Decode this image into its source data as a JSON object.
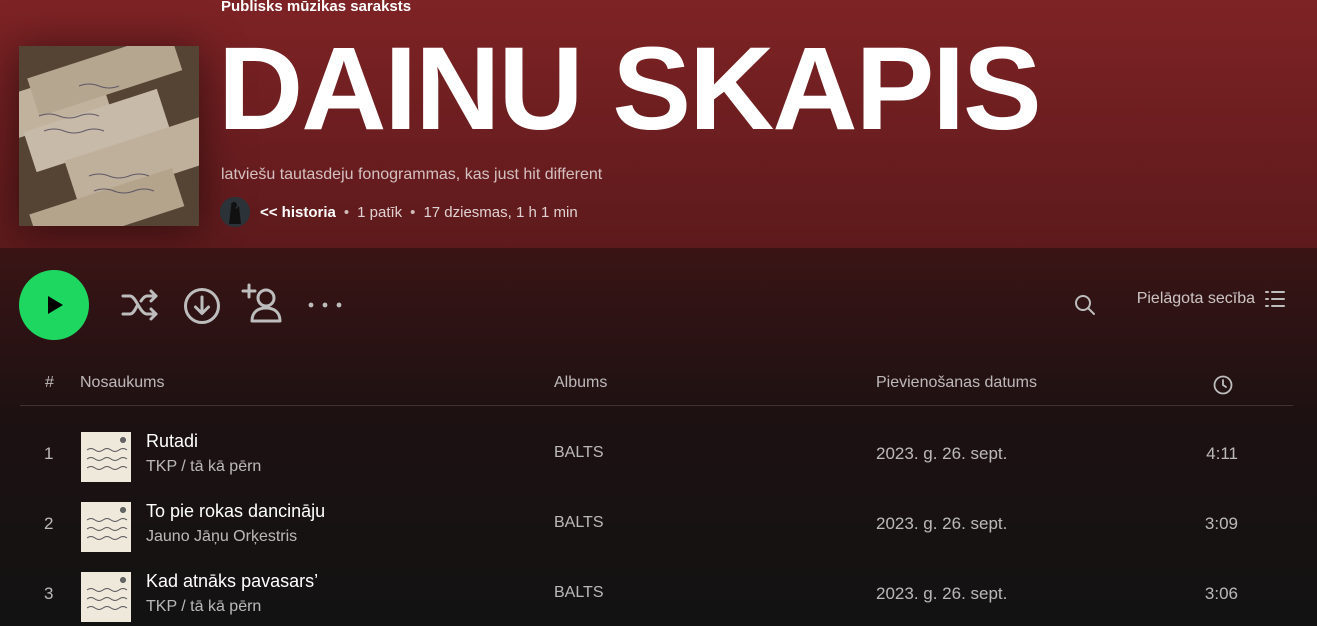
{
  "playlist": {
    "type_label": "Publisks mūzikas saraksts",
    "title": "DAINU SKAPIS",
    "description": "latviešu tautasdeju fonogrammas, kas just hit different",
    "owner": "<< historia",
    "likes": "1 patīk",
    "summary": "17 dziesmas, 1 h 1 min",
    "separator": "•"
  },
  "colors": {
    "header": "#7e2325",
    "accent": "#1ed760",
    "background": "#121212"
  },
  "controls": {
    "play_icon": "play-icon",
    "shuffle_icon": "shuffle-icon",
    "download_icon": "download-icon",
    "add_user_icon": "add-user-icon",
    "more_icon": "more-icon",
    "search_icon": "search-icon",
    "sort_label": "Pielāgota secība",
    "sort_icon": "list-icon"
  },
  "table": {
    "headers": {
      "number": "#",
      "title": "Nosaukums",
      "album": "Albums",
      "date_added": "Pievienošanas datums",
      "duration_icon": "clock-icon"
    },
    "rows": [
      {
        "number": "1",
        "title": "Rutadi",
        "artist": "TKP / tā kā pērn",
        "album": "BALTS",
        "date": "2023. g. 26. sept.",
        "duration": "4:11"
      },
      {
        "number": "2",
        "title": "To pie rokas dancināju",
        "artist": "Jauno Jāņu Orķestris",
        "album": "BALTS",
        "date": "2023. g. 26. sept.",
        "duration": "3:09"
      },
      {
        "number": "3",
        "title": "Kad atnāks pavasars’",
        "artist": "TKP / tā kā pērn",
        "album": "BALTS",
        "date": "2023. g. 26. sept.",
        "duration": "3:06"
      }
    ]
  }
}
